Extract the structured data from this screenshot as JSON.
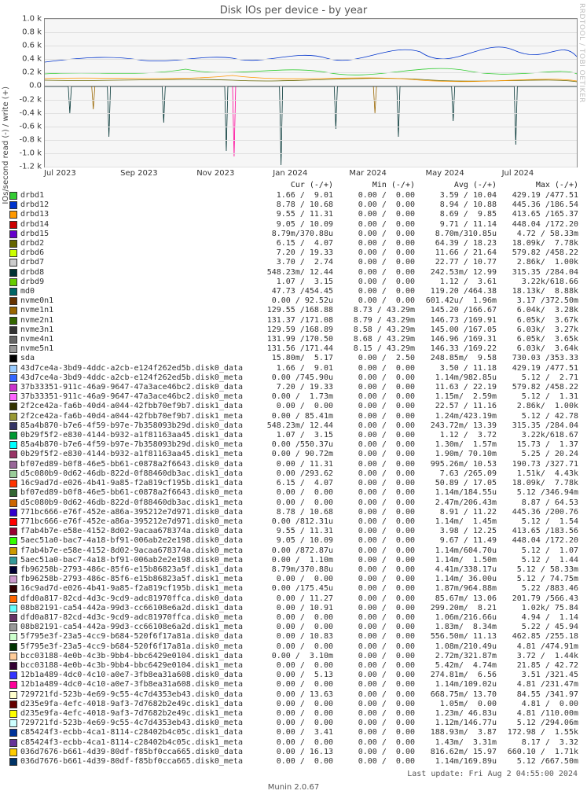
{
  "title": "Disk IOs per device - by year",
  "ylabel": "IOs/second read (-) / write (+)",
  "watermark": "RRDTOOL / TOBI OETIKER",
  "footer_left": "Munin 2.0.67",
  "footer_right": "Last update: Fri Aug  2 04:55:00 2024",
  "headers": {
    "name": "",
    "cur": "Cur (-/+)",
    "min": "Min (-/+)",
    "avg": "Avg (-/+)",
    "max": "Max (-/+)"
  },
  "yticks": [
    "1.0 k",
    "0.8 k",
    "0.6 k",
    "0.4 k",
    "0.2 k",
    "0.0",
    "-0.2 k",
    "-0.4 k",
    "-0.6 k",
    "-0.8 k",
    "-1.0 k",
    "-1.2 k"
  ],
  "xticks": [
    "Jul 2023",
    "Sep 2023",
    "Nov 2023",
    "Jan 2024",
    "Mar 2024",
    "May 2024",
    "Jul 2024"
  ],
  "chart_data": {
    "type": "line",
    "x_range": [
      "2023-06",
      "2024-08"
    ],
    "y_range": [
      -1200,
      1000
    ],
    "y_tick_step": 200,
    "note": "Multi-series positive/negative IO rates; values in legend table below.",
    "series_ref": "rows"
  },
  "rows": [
    {
      "c": "#33cc33",
      "n": "drbd1",
      "cur": "1.66 /  9.01",
      "min": "0.00 /  0.00",
      "avg": "3.59 / 10.04",
      "max": "429.19 /477.51"
    },
    {
      "c": "#0033cc",
      "n": "drbd12",
      "cur": "8.78 / 10.68",
      "min": "0.00 /  0.00",
      "avg": "8.94 / 10.88",
      "max": "445.36 /186.54"
    },
    {
      "c": "#ff9900",
      "n": "drbd13",
      "cur": "9.55 / 11.31",
      "min": "0.00 /  0.00",
      "avg": "8.69 /  9.85",
      "max": "413.65 /165.37"
    },
    {
      "c": "#cc0000",
      "n": "drbd14",
      "cur": "9.05 / 10.09",
      "min": "0.00 /  0.00",
      "avg": "9.71 / 11.14",
      "max": "448.04 /172.20"
    },
    {
      "c": "#6600cc",
      "n": "drbd15",
      "cur": "8.79m/370.88u",
      "min": "0.00 /  0.00",
      "avg": "8.70m/310.85u",
      "max": "4.72 / 58.33m"
    },
    {
      "c": "#666600",
      "n": "drbd2",
      "cur": "6.15 /  4.07",
      "min": "0.00 /  0.00",
      "avg": "64.39 / 18.23",
      "max": "18.09k/  7.78k"
    },
    {
      "c": "#ccff00",
      "n": "drbd6",
      "cur": "7.20 / 19.33",
      "min": "0.00 /  0.00",
      "avg": "11.66 / 21.64",
      "max": "579.82 /458.22"
    },
    {
      "c": "#cccccc",
      "n": "drbd7",
      "cur": "3.70 /  2.74",
      "min": "0.00 /  0.00",
      "avg": "22.77 / 10.77",
      "max": "2.86k/  1.00k"
    },
    {
      "c": "#003333",
      "n": "drbd8",
      "cur": "548.23m/ 12.44",
      "min": "0.00 /  0.00",
      "avg": "242.53m/ 12.99",
      "max": "315.35 /284.04"
    },
    {
      "c": "#66cc00",
      "n": "drbd9",
      "cur": "1.07 /  3.15",
      "min": "0.00 /  0.00",
      "avg": "1.12 /  3.61",
      "max": "3.22k/618.66"
    },
    {
      "c": "#006666",
      "n": "md0",
      "cur": "47.73 /454.45",
      "min": "0.00 /  0.00",
      "avg": "119.20 /464.38",
      "max": "18.13k/  8.88k"
    },
    {
      "c": "#663300",
      "n": "nvme0n1",
      "cur": "0.00 / 92.52u",
      "min": "0.00 /  0.00",
      "avg": "601.42u/  1.96m",
      "max": "3.17 /372.50m"
    },
    {
      "c": "#996600",
      "n": "nvme1n1",
      "cur": "129.55 /168.88",
      "min": "8.73 / 43.29m",
      "avg": "145.20 /166.67",
      "max": "6.04k/  3.28k"
    },
    {
      "c": "#336600",
      "n": "nvme2n1",
      "cur": "131.37 /171.08",
      "min": "8.79 / 43.29m",
      "avg": "146.73 /169.91",
      "max": "6.05k/  3.67k"
    },
    {
      "c": "#333333",
      "n": "nvme3n1",
      "cur": "129.59 /168.89",
      "min": "8.58 / 43.29m",
      "avg": "145.00 /167.05",
      "max": "6.03k/  3.27k"
    },
    {
      "c": "#666666",
      "n": "nvme4n1",
      "cur": "131.99 /170.50",
      "min": "8.68 / 43.29m",
      "avg": "146.96 /169.31",
      "max": "6.05k/  3.65k"
    },
    {
      "c": "#999999",
      "n": "nvme5n1",
      "cur": "131.56 /171.44",
      "min": "8.15 / 43.29m",
      "avg": "146.33 /169.22",
      "max": "6.03k/  3.64k"
    },
    {
      "c": "#000000",
      "n": "sda",
      "cur": "15.80m/  5.17",
      "min": "0.00 /  2.50",
      "avg": "248.85m/  9.58",
      "max": "730.03 /353.33"
    },
    {
      "c": "#99ccff",
      "n": "43d7ce4a-3bd9-4ddc-a2cb-e124f262ed5b.disk0_data",
      "cur": "1.66 /  9.01",
      "min": "0.00 /  0.00",
      "avg": "3.50 / 11.18",
      "max": "429.19 /477.51"
    },
    {
      "c": "#3366ff",
      "n": "43d7ce4a-3bd9-4ddc-a2cb-e124f262ed5b.disk0_meta",
      "cur": "0.00 /745.90u",
      "min": "0.00 /  0.00",
      "avg": "1.14m/982.85u",
      "max": "5.12 /  2.71"
    },
    {
      "c": "#cc33cc",
      "n": "37b33351-911c-46a9-9647-47a3ace46bc2.disk0_data",
      "cur": "7.20 / 19.33",
      "min": "0.00 /  0.00",
      "avg": "11.63 / 22.19",
      "max": "579.82 /458.22"
    },
    {
      "c": "#ff66ff",
      "n": "37b33351-911c-46a9-9647-47a3ace46bc2.disk0_meta",
      "cur": "0.00 /  1.73m",
      "min": "0.00 /  0.00",
      "avg": "1.15m/  2.59m",
      "max": "5.12 /  1.31"
    },
    {
      "c": "#333300",
      "n": "2f2ce42a-fa6b-40d4-a044-42fbb70ef9b7.disk1_data",
      "cur": "0.00 /  0.00",
      "min": "0.00 /  0.00",
      "avg": "22.57 / 11.16",
      "max": "2.86k/  1.00k"
    },
    {
      "c": "#999933",
      "n": "2f2ce42a-fa6b-40d4-a044-42fbb70ef9b7.disk1_meta",
      "cur": "0.00 / 85.41m",
      "min": "0.00 /  0.00",
      "avg": "1.24m/423.19m",
      "max": "5.12 / 42.78"
    },
    {
      "c": "#333366",
      "n": "85a4b870-b7e6-4f59-b97e-7b358093b29d.disk0_data",
      "cur": "548.23m/ 12.44",
      "min": "0.00 /  0.00",
      "avg": "243.72m/ 13.39",
      "max": "315.35 /284.04"
    },
    {
      "c": "#009933",
      "n": "0b29f5f2-e830-4144-b932-a1f81163aa45.disk1_data",
      "cur": "1.07 /  3.15",
      "min": "0.00 /  0.00",
      "avg": "1.12 /  3.72",
      "max": "3.22k/618.67"
    },
    {
      "c": "#00ffff",
      "n": "85a4b870-b7e6-4f59-b97e-7b358093b29d.disk0_meta",
      "cur": "0.00 /550.37u",
      "min": "0.00 /  0.00",
      "avg": "1.30m/  1.57m",
      "max": "15.73 /  1.37"
    },
    {
      "c": "#993366",
      "n": "0b29f5f2-e830-4144-b932-a1f81163aa45.disk1_meta",
      "cur": "0.00 / 90.72m",
      "min": "0.00 /  0.00",
      "avg": "1.90m/ 70.10m",
      "max": "5.25 / 20.24"
    },
    {
      "c": "#996699",
      "n": "bf07ed89-b0f8-46e5-bb61-c0878a2f6643.disk0_data",
      "cur": "0.00 / 11.31",
      "min": "0.00 /  0.00",
      "avg": "995.26m/ 10.53",
      "max": "190.73 /327.71"
    },
    {
      "c": "#99cc99",
      "n": "d5c080b9-0d62-46db-822d-0f88460db3ac.disk1_data",
      "cur": "0.00 /293.62",
      "min": "0.00 /  0.00",
      "avg": "7.63 /265.09",
      "max": "1.51k/  4.43k"
    },
    {
      "c": "#ff3300",
      "n": "16c9ad7d-e026-4b41-9a85-f2a819cf195b.disk1_data",
      "cur": "6.15 /  4.07",
      "min": "0.00 /  0.00",
      "avg": "50.89 / 17.05",
      "max": "18.09k/  7.78k"
    },
    {
      "c": "#336633",
      "n": "bf07ed89-b0f8-46e5-bb61-c0878a2f6643.disk0_meta",
      "cur": "0.00 /  0.00",
      "min": "0.00 /  0.00",
      "avg": "1.14m/184.55u",
      "max": "5.12 /346.94m"
    },
    {
      "c": "#cc6600",
      "n": "d5c080b9-0d62-46db-822d-0f88460db3ac.disk1_meta",
      "cur": "0.00 /  0.00",
      "min": "0.00 /  0.00",
      "avg": "2.47m/206.43m",
      "max": "8.87 / 64.53"
    },
    {
      "c": "#3300cc",
      "n": "771bc666-e76f-452e-a86a-395212e7d971.disk0_data",
      "cur": "8.78 / 10.68",
      "min": "0.00 /  0.00",
      "avg": "8.91 / 11.22",
      "max": "445.36 /200.76"
    },
    {
      "c": "#ff0000",
      "n": "771bc666-e76f-452e-a86a-395212e7d971.disk0_meta",
      "cur": "0.00 /812.31u",
      "min": "0.00 /  0.00",
      "avg": "1.14m/  1.45m",
      "max": "5.12 /  1.54"
    },
    {
      "c": "#990033",
      "n": "f7ab4b7e-e58e-4152-8d02-9acaa678374a.disk0_data",
      "cur": "9.55 / 11.31",
      "min": "0.00 /  0.00",
      "avg": "3.98 / 12.25",
      "max": "413.65 /183.56"
    },
    {
      "c": "#33ff00",
      "n": "5aec51a0-bac7-4a18-bf91-006ab2e2e198.disk0_data",
      "cur": "9.05 / 10.09",
      "min": "0.00 /  0.00",
      "avg": "9.67 / 11.49",
      "max": "448.04 /172.20"
    },
    {
      "c": "#cc9900",
      "n": "f7ab4b7e-e58e-4152-8d02-9acaa678374a.disk0_meta",
      "cur": "0.00 /872.87u",
      "min": "0.00 /  0.00",
      "avg": "1.14m/604.70u",
      "max": "5.12 /  1.07"
    },
    {
      "c": "#339999",
      "n": "5aec51a0-bac7-4a18-bf91-006ab2e2e198.disk0_meta",
      "cur": "0.00 /  1.10m",
      "min": "0.00 /  0.00",
      "avg": "1.14m/  1.50m",
      "max": "5.12 /  1.44"
    },
    {
      "c": "#000033",
      "n": "fb96258b-2793-486c-85f6-e15b86823a5f.disk1_data",
      "cur": "8.79m/370.88u",
      "min": "0.00 /  0.00",
      "avg": "4.41m/338.17u",
      "max": "5.12 / 58.33m"
    },
    {
      "c": "#cc99cc",
      "n": "fb96258b-2793-486c-85f6-e15b86823a5f.disk1_meta",
      "cur": "0.00 /  0.00",
      "min": "0.00 /  0.00",
      "avg": "1.14m/ 36.00u",
      "max": "5.12 / 74.75m"
    },
    {
      "c": "#330000",
      "n": "16c9ad7d-e026-4b41-9a85-f2a819cf195b.disk1_meta",
      "cur": "0.00 /175.45u",
      "min": "0.00 /  0.00",
      "avg": "1.87m/964.88m",
      "max": "5.22 /883.46"
    },
    {
      "c": "#ff6600",
      "n": "dfd0a817-82cd-4d3c-9cd9-adc81970ffca.disk0_data",
      "cur": "0.00 / 11.27",
      "min": "0.00 /  0.00",
      "avg": "85.67m/ 13.06",
      "max": "201.79 /566.43"
    },
    {
      "c": "#66ffff",
      "n": "08b82191-ca54-442a-99d3-cc66108e6a2d.disk1_data",
      "cur": "0.00 / 10.91",
      "min": "0.00 /  0.00",
      "avg": "299.20m/  8.21",
      "max": "1.02k/ 75.84"
    },
    {
      "c": "#663366",
      "n": "dfd0a817-82cd-4d3c-9cd9-adc81970ffca.disk0_meta",
      "cur": "0.00 /  0.00",
      "min": "0.00 /  0.00",
      "avg": "1.06m/216.66u",
      "max": "4.94 /  1.14"
    },
    {
      "c": "#999999",
      "n": "08b82191-ca54-442a-99d3-cc66108e6a2d.disk1_meta",
      "cur": "0.00 /  0.00",
      "min": "0.00 /  0.00",
      "avg": "1.83m/  8.34m",
      "max": "5.22 / 45.94"
    },
    {
      "c": "#ccffcc",
      "n": "5f795e3f-23a5-4cc9-b684-520f6f17a81a.disk0_data",
      "cur": "0.00 / 10.83",
      "min": "0.00 /  0.00",
      "avg": "556.50m/ 11.13",
      "max": "462.85 /255.18"
    },
    {
      "c": "#003300",
      "n": "5f795e3f-23a5-4cc9-b684-520f6f17a81a.disk0_meta",
      "cur": "0.00 /  0.00",
      "min": "0.00 /  0.00",
      "avg": "1.08m/210.49u",
      "max": "4.81 /474.91m"
    },
    {
      "c": "#ffcc99",
      "n": "bcc03188-4e0b-4c3b-9bb4-bbc6429e0104.disk1_data",
      "cur": "0.00 /  3.10m",
      "min": "0.00 /  0.00",
      "avg": "2.72m/321.87m",
      "max": "3.72 /  1.44k"
    },
    {
      "c": "#330033",
      "n": "bcc03188-4e0b-4c3b-9bb4-bbc6429e0104.disk1_meta",
      "cur": "0.00 /  0.00",
      "min": "0.00 /  0.00",
      "avg": "5.42m/  4.74m",
      "max": "21.85 / 42.72"
    },
    {
      "c": "#3333ff",
      "n": "12b1a489-4dc0-4c10-a0e7-3fb8ea31a608.disk0_data",
      "cur": "0.00 /  5.13",
      "min": "0.00 /  0.00",
      "avg": "274.81m/  6.56",
      "max": "3.51 /321.45"
    },
    {
      "c": "#ff0099",
      "n": "12b1a489-4dc0-4c10-a0e7-3fb8ea31a608.disk0_meta",
      "cur": "0.00 /  0.00",
      "min": "0.00 /  0.00",
      "avg": "1.14m/109.02u",
      "max": "4.81 /231.47m"
    },
    {
      "c": "#ffffcc",
      "n": "729721fd-523b-4e69-9c55-4c7d4353eb43.disk0_data",
      "cur": "0.00 / 13.63",
      "min": "0.00 /  0.00",
      "avg": "668.75m/ 13.70",
      "max": "84.55 /341.97"
    },
    {
      "c": "#660000",
      "n": "d235e9fa-4efc-4018-9af3-7d7682b2e49c.disk1_data",
      "cur": "0.00 /  0.00",
      "min": "0.00 /  0.00",
      "avg": "1.05m/  0.00",
      "max": "4.81 /  0.00"
    },
    {
      "c": "#ffff00",
      "n": "d235e9fa-4efc-4018-9af3-7d7682b2e49c.disk1_meta",
      "cur": "0.00 /  0.00",
      "min": "0.00 /  0.00",
      "avg": "1.23m/ 46.83u",
      "max": "4.81 /110.00m"
    },
    {
      "c": "#ccffff",
      "n": "729721fd-523b-4e69-9c55-4c7d4353eb43.disk0_meta",
      "cur": "0.00 /  0.00",
      "min": "0.00 /  0.00",
      "avg": "1.12m/146.77u",
      "max": "5.12 /294.06m"
    },
    {
      "c": "#003399",
      "n": "c85424f3-ecbb-4ca1-8114-c28402b4c05c.disk1_data",
      "cur": "0.00 /  3.41",
      "min": "0.00 /  0.00",
      "avg": "188.93m/  3.87",
      "max": "172.98 /  1.55k"
    },
    {
      "c": "#663399",
      "n": "c85424f3-ecbb-4ca1-8114-c28402b4c05c.disk1_meta",
      "cur": "0.00 /  0.00",
      "min": "0.00 /  0.00",
      "avg": "1.43m/  3.31m",
      "max": "8.17 /  3.32"
    },
    {
      "c": "#ffcc00",
      "n": "036d7676-b661-4d39-80df-f85bf0cca665.disk0_data",
      "cur": "0.00 / 16.13",
      "min": "0.00 /  0.00",
      "avg": "816.62m/ 15.97",
      "max": "660.10 /  1.71k"
    },
    {
      "c": "#003366",
      "n": "036d7676-b661-4d39-80df-f85bf0cca665.disk0_meta",
      "cur": "0.00 /  0.00",
      "min": "0.00 /  0.00",
      "avg": "1.14m/169.89u",
      "max": "5.12 /667.50m"
    }
  ]
}
